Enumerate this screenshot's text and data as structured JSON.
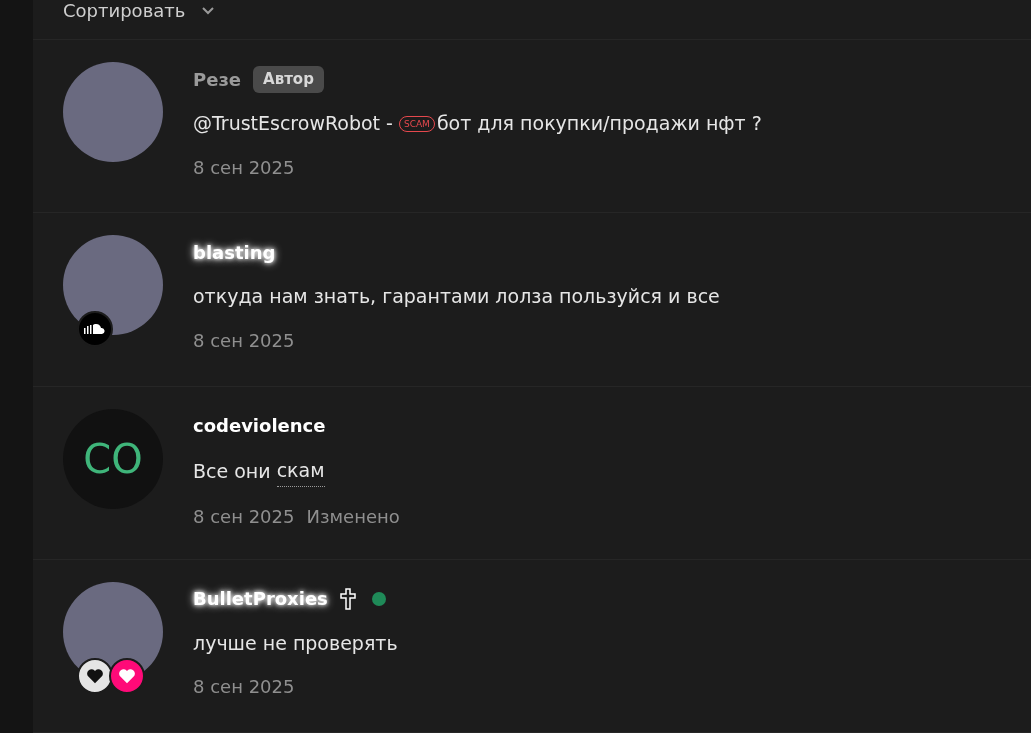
{
  "sort": {
    "label": "Сортировать"
  },
  "comments": [
    {
      "author": "Резе",
      "muted": true,
      "glow": false,
      "badge": "Автор",
      "avatar": {
        "kind": "photo"
      },
      "cross": false,
      "online": false,
      "text": [
        {
          "kind": "text",
          "text": "@TrustEscrowRobot - "
        },
        {
          "kind": "tag",
          "text": "SCAM"
        },
        {
          "kind": "text",
          "text": "бот для покупки/продажи нфт ?"
        }
      ],
      "date": "8 сен 2025"
    },
    {
      "author": "blasting",
      "muted": false,
      "glow": true,
      "avatar": {
        "kind": "photo"
      },
      "avatar_badges": [
        {
          "kind": "cloud"
        }
      ],
      "cross": false,
      "online": false,
      "text": [
        {
          "kind": "text",
          "text": "откуда нам знать, гарантами лолза пользуйся и все"
        }
      ],
      "date": "8 сен 2025"
    },
    {
      "author": "codeviolence",
      "muted": false,
      "glow": false,
      "avatar": {
        "kind": "initials",
        "initials": "CO"
      },
      "cross": false,
      "online": false,
      "text": [
        {
          "kind": "text",
          "text": "Все они "
        },
        {
          "kind": "term",
          "text": "скам"
        }
      ],
      "date": "8 сен 2025",
      "edited": "Изменено"
    },
    {
      "author": "BulletProxies",
      "muted": false,
      "glow": true,
      "avatar": {
        "kind": "photo"
      },
      "avatar_badges": [
        {
          "kind": "heart-dark"
        },
        {
          "kind": "heart-pink"
        }
      ],
      "cross": true,
      "online": true,
      "text": [
        {
          "kind": "text",
          "text": "лучше не проверять"
        }
      ],
      "date": "8 сен 2025"
    }
  ]
}
